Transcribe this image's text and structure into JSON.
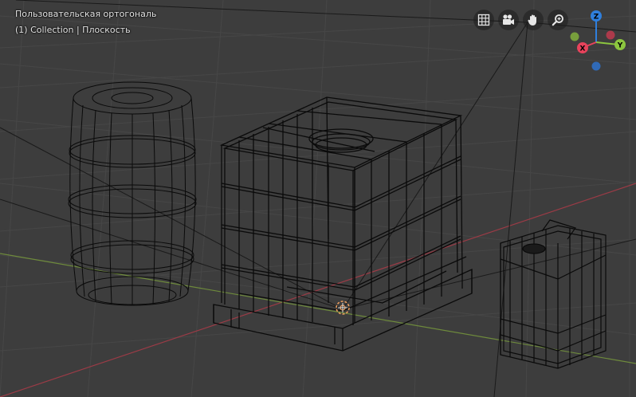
{
  "viewport": {
    "view_name": "Пользовательская ортогональ",
    "collection_line": "(1) Collection | Плоскость"
  },
  "navigation": {
    "buttons": [
      {
        "name": "toggle-grid-view",
        "icon": "grid-icon"
      },
      {
        "name": "toggle-camera-view",
        "icon": "camera-icon"
      },
      {
        "name": "pan-view",
        "icon": "hand-icon"
      },
      {
        "name": "zoom-view",
        "icon": "magnifier-icon"
      }
    ]
  },
  "gizmo": {
    "axes": {
      "z": {
        "label": "Z",
        "color": "#2f7fdd"
      },
      "y": {
        "label": "Y",
        "color": "#8cc63f"
      },
      "x": {
        "label": "X",
        "color": "#e8435c"
      }
    }
  },
  "colors": {
    "background": "#3d3d3d",
    "grid": "#4a4a4a",
    "wire": "#000000",
    "x_axis_line": "#9b3b46",
    "y_axis_line": "#6e8a3c",
    "origin": "#f0a060"
  },
  "objects": [
    {
      "name": "barrel",
      "type": "wireframe"
    },
    {
      "name": "ibc-tank",
      "type": "wireframe"
    },
    {
      "name": "canister",
      "type": "wireframe"
    }
  ]
}
